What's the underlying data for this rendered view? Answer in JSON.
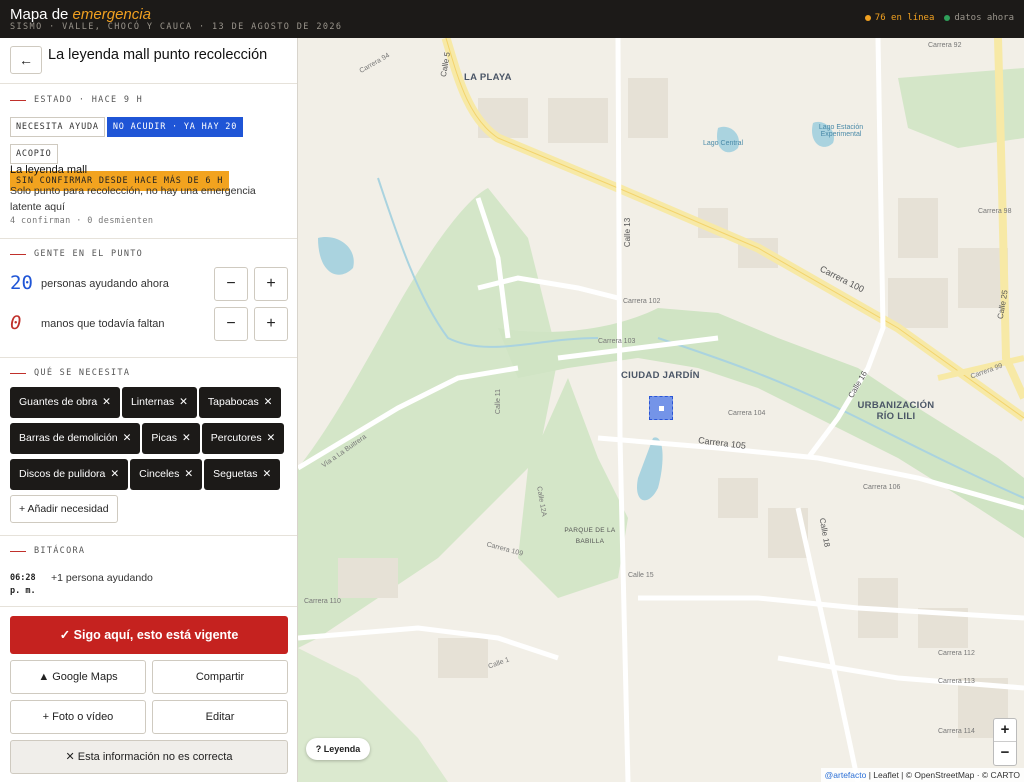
{
  "topbar": {
    "brand_prefix": "Mapa de ",
    "brand_accent": "emergencia",
    "subtitle": "SISMO · VALLE, CHOCÓ Y CAUCA · 13 DE AGOSTO DE 2026",
    "online": "76 en línea",
    "fresh": "datos ahora",
    "online_color": "#f0a020",
    "fresh_color": "#2fa05a"
  },
  "point": {
    "back_icon": "←",
    "title": "La leyenda mall punto recolección",
    "status_label": "ESTADO · HACE 9 H",
    "tags": [
      {
        "label": "NECESITA AYUDA",
        "state": "normal"
      },
      {
        "label": "NO ACUDIR · YA HAY 20",
        "state": "active"
      },
      {
        "label": "ACOPIO",
        "state": "normal"
      }
    ],
    "warning": "SIN CONFIRMAR DESDE HACE MÁS DE 6 H",
    "name": "La leyenda mall",
    "description": "Solo punto para recolección, no hay una emergencia latente aquí",
    "confirmations": "4 confirman · 0 desmienten"
  },
  "people": {
    "label": "GENTE EN EL PUNTO",
    "helping_count": "20",
    "helping_label": "personas ayudando ahora",
    "missing_count": "0",
    "missing_label": "manos que todavía faltan",
    "minus": "−",
    "plus": "+"
  },
  "needs": {
    "label": "QUÉ SE NECESITA",
    "items": [
      "Guantes de obra",
      "Linternas",
      "Tapabocas",
      "Barras de demolición",
      "Picas",
      "Percutores",
      "Discos de pulidora",
      "Cinceles",
      "Seguetas"
    ],
    "remove_icon": "✕",
    "add_label": "+ Añadir necesidad"
  },
  "log": {
    "label": "BITÁCORA",
    "entries": [
      {
        "time": "06:28 p. m.",
        "text": "+1 persona ayudando"
      }
    ]
  },
  "actions": {
    "confirm": "✓ Sigo aquí, esto está vigente",
    "google_maps": "▲ Google Maps",
    "share": "Compartir",
    "photo": "+ Foto o vídeo",
    "edit": "Editar",
    "incorrect": "✕ Esta información no es correcta"
  },
  "map": {
    "districts": [
      "LA PLAYA",
      "CIUDAD JARDÍN",
      "URBANIZACIÓN RÍO LILI",
      "PARQUE DE LA BABILLA"
    ],
    "places": [
      "Lago Central",
      "Lago Estación Experimental"
    ],
    "streets": [
      "Carrera 100",
      "Carrera 105",
      "Carrera 102",
      "Calle 13",
      "Calle 5",
      "Calle 16",
      "Calle 18",
      "Calle 25",
      "Carrera 99",
      "Carrera 98",
      "Vía a La Buitrera",
      "Carrera 94",
      "Carrera 92",
      "Calle 15",
      "Carrera 109",
      "Carrera 110",
      "Carrera 112",
      "Carrera 113",
      "Carrera 114",
      "Carrera 106",
      "Carrera 104",
      "Carrera 103",
      "Calle 11",
      "Calle 12A",
      "Calle 1"
    ],
    "legend": "? Leyenda",
    "zoom_in": "+",
    "zoom_out": "−",
    "attribution_link": "@artefacto",
    "attribution_rest": " | Leaflet | © OpenStreetMap · © CARTO",
    "marker_color": "#3f6ee8"
  }
}
